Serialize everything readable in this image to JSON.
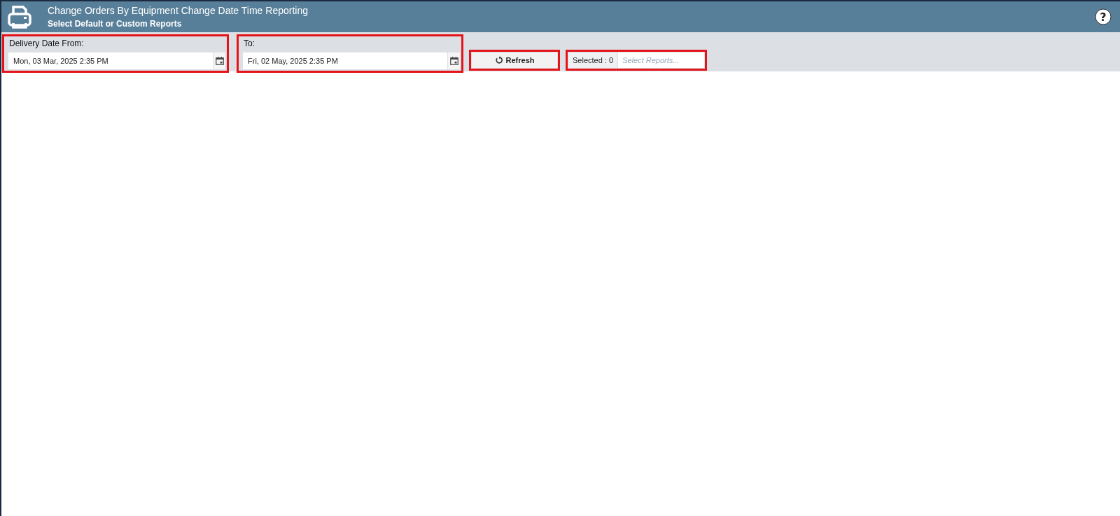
{
  "header": {
    "title": "Change Orders By Equipment Change Date Time Reporting",
    "subtitle": "Select Default or Custom Reports",
    "help_glyph": "?"
  },
  "filters": [
    {
      "label": "Delivery Date From:",
      "value": "Mon, 03 Mar, 2025 2:35 PM",
      "highlighted": true
    },
    {
      "label": "To:",
      "value": "Fri, 02 May, 2025 2:35 PM",
      "highlighted": true
    }
  ],
  "refresh_button": {
    "label": "Refresh",
    "highlighted": true
  },
  "report_select": {
    "count_label": "Selected : 0",
    "placeholder": "Select Reports...",
    "highlighted": true
  }
}
